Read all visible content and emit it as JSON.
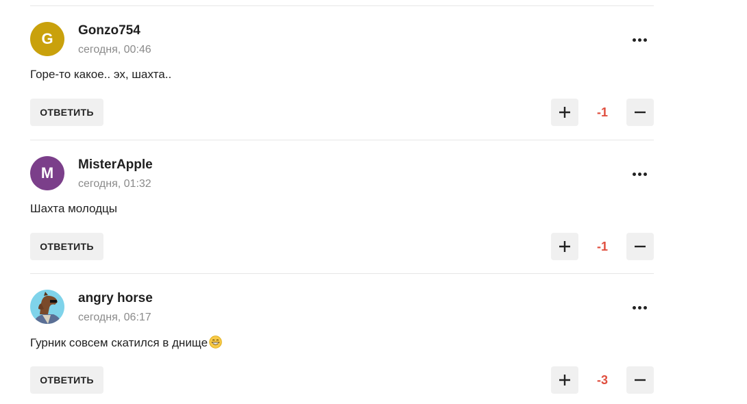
{
  "comments": [
    {
      "author": "Gonzo754",
      "time": "сегодня, 00:46",
      "avatar_letter": "G",
      "avatar_color": "#c9a10c",
      "text": "Горе-то какое.. эх, шахта..",
      "reply_label": "ОТВЕТИТЬ",
      "score": "-1"
    },
    {
      "author": "MisterApple",
      "time": "сегодня, 01:32",
      "avatar_letter": "M",
      "avatar_color": "#7b3f8a",
      "text": "Шахта молодцы",
      "reply_label": "ОТВЕТИТЬ",
      "score": "-1"
    },
    {
      "author": "angry horse",
      "time": "сегодня, 06:17",
      "avatar_letter": "",
      "avatar_color": "#7fd3ea",
      "text": "Гурник совсем скатился в днище",
      "text_emoji": "grinning-face-emoji",
      "reply_label": "ОТВЕТИТЬ",
      "score": "-3"
    }
  ],
  "score_color": "#e04f3f"
}
